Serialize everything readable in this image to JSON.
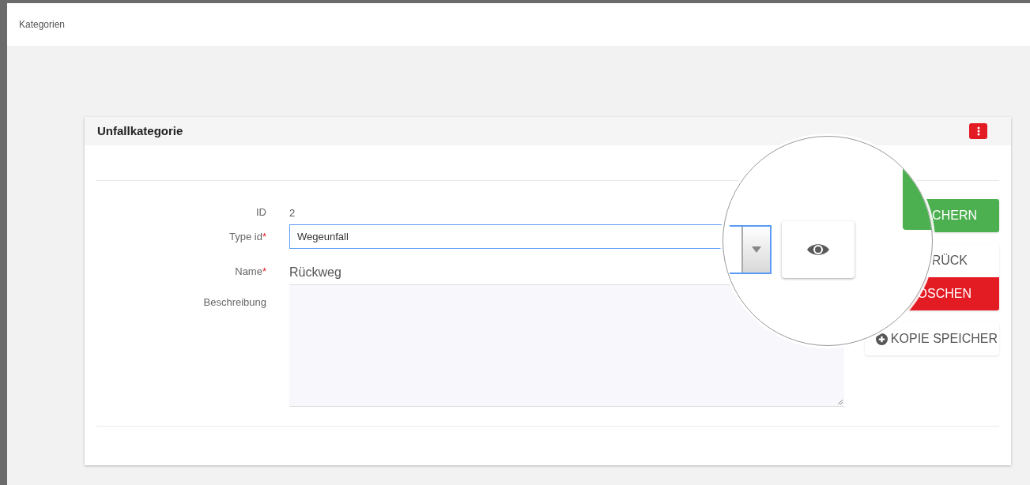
{
  "header": {
    "title": "Kategorien"
  },
  "card": {
    "title": "Unfallkategorie"
  },
  "fields": [
    {
      "kind": "static",
      "label": "ID",
      "value": "2"
    },
    {
      "kind": "select",
      "label": "Type id",
      "required_mark": "*",
      "value": "Wegeunfall",
      "focused": true
    },
    {
      "kind": "text",
      "label": "Name",
      "required_mark": "*",
      "value": "Rückweg"
    },
    {
      "kind": "textarea",
      "label": "Beschreibung"
    }
  ],
  "buttons": [
    {
      "kind": "save",
      "label": "CHERN"
    },
    {
      "kind": "back",
      "label": "RÜCK"
    },
    {
      "kind": "delete",
      "label": "ÖSCHEN"
    },
    {
      "kind": "copy",
      "label": "KOPIE SPEICHER"
    }
  ]
}
